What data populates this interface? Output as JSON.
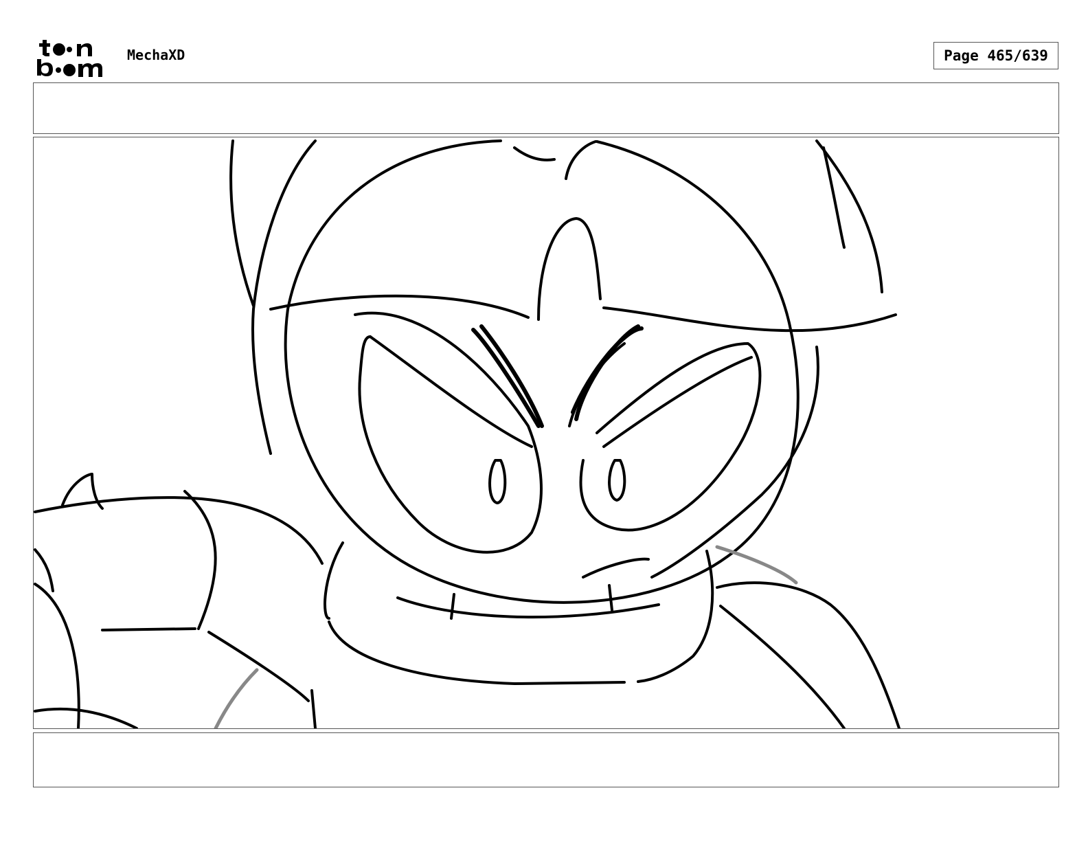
{
  "brand": {
    "logo_text": "toon boom"
  },
  "project": {
    "title": "MechaXD"
  },
  "page": {
    "indicator": "Page 465/639"
  },
  "panel": {
    "description": ""
  },
  "caption": {
    "text": ""
  }
}
